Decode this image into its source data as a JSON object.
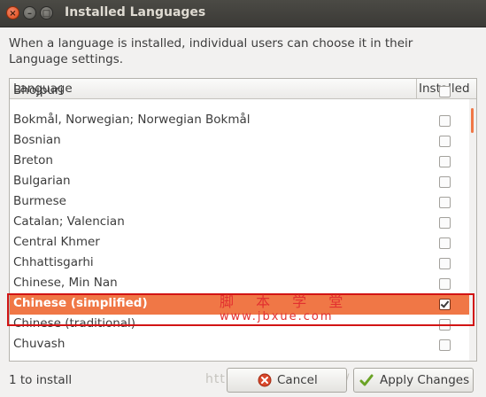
{
  "window": {
    "title": "Installed Languages",
    "close_glyph": "×",
    "min_glyph": "–",
    "max_glyph": "□"
  },
  "description": "When a language is installed, individual users can choose it in their Language settings.",
  "list": {
    "header_language": "Language",
    "header_installed": "Installed",
    "rows": [
      {
        "label": "Bhojpuri",
        "checked": false
      },
      {
        "label": "Bokmål, Norwegian; Norwegian Bokmål",
        "checked": false
      },
      {
        "label": "Bosnian",
        "checked": false
      },
      {
        "label": "Breton",
        "checked": false
      },
      {
        "label": "Bulgarian",
        "checked": false
      },
      {
        "label": "Burmese",
        "checked": false
      },
      {
        "label": "Catalan; Valencian",
        "checked": false
      },
      {
        "label": "Central Khmer",
        "checked": false
      },
      {
        "label": "Chhattisgarhi",
        "checked": false
      },
      {
        "label": "Chinese, Min Nan",
        "checked": false
      },
      {
        "label": "Chinese (simplified)",
        "checked": true,
        "selected": true
      },
      {
        "label": "Chinese (traditional)",
        "checked": false
      },
      {
        "label": "Chuvash",
        "checked": false
      }
    ]
  },
  "watermark": {
    "line1": "脚 本 学 堂",
    "line2": "www.jbxue.com",
    "bottom": "http://blog.csdn.net/"
  },
  "status": "1 to install",
  "buttons": {
    "cancel": "Cancel",
    "apply": "Apply Changes"
  },
  "colors": {
    "accent": "#f07746",
    "titlebar": "#3c3b37",
    "highlight_box": "#d21414"
  },
  "icons": {
    "cancel": "cancel-icon",
    "apply": "checkmark-icon"
  }
}
